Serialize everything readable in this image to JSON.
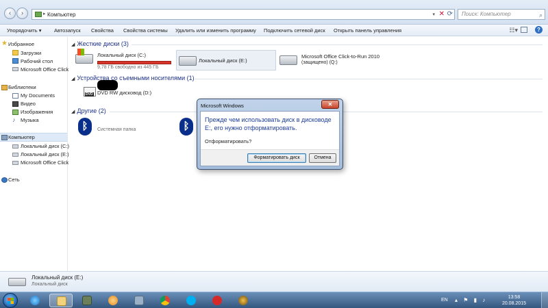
{
  "address": {
    "crumb": "Компьютер"
  },
  "search": {
    "placeholder": "Поиск: Компьютер"
  },
  "toolbar": {
    "organize": "Упорядочить ▾",
    "autoplay": "Автозапуск",
    "properties": "Свойства",
    "system_properties": "Свойства системы",
    "uninstall": "Удалить или изменить программу",
    "map_drive": "Подключить сетевой диск",
    "control_panel": "Открыть панель управления"
  },
  "sidebar": {
    "favorites": "Избранное",
    "downloads": "Загрузки",
    "desktop": "Рабочий стол",
    "office": "Microsoft Office Click",
    "libraries": "Библиотеки",
    "documents": "My Documents",
    "video": "Видео",
    "images": "Изображения",
    "music": "Музыка",
    "computer": "Компьютер",
    "drive_c": "Локальный диск (C:)",
    "drive_e": "Локальный диск (E:)",
    "office2": "Microsoft Office Click",
    "network": "Сеть"
  },
  "main": {
    "hard_disks": "Жесткие диски (3)",
    "removable": "Устройства со съемными носителями (1)",
    "other": "Другие (2)",
    "drive_c": {
      "name": "Локальный диск (C:)",
      "free": "9,78 ГБ свободно из 445 ГБ",
      "used_fraction": 0.978
    },
    "drive_e": {
      "name": "Локальный диск (E:)"
    },
    "drive_q": {
      "name": "Microsoft Office Click-to-Run 2010",
      "sub": "(защищено) (Q:)"
    },
    "dvd": {
      "name": "DVD RW дисковод (D:)"
    },
    "other_item": {
      "sub": "Системная папка"
    }
  },
  "dialog": {
    "title": "Microsoft Windows",
    "message": "Прежде чем использовать диск в дисководе E:, его нужно отформатировать.",
    "question": "Отформатировать?",
    "format_button": "Форматировать диск",
    "cancel_button": "Отмена"
  },
  "details": {
    "name": "Локальный диск (E:)",
    "type": "Локальный диск"
  },
  "taskbar": {
    "lang": "EN",
    "time": "13:58",
    "date": "20.08.2015",
    "apps": [
      "ie",
      "explorer",
      "folder-apps",
      "media",
      "tools",
      "chrome",
      "skype",
      "app-14",
      "warcraft"
    ]
  }
}
